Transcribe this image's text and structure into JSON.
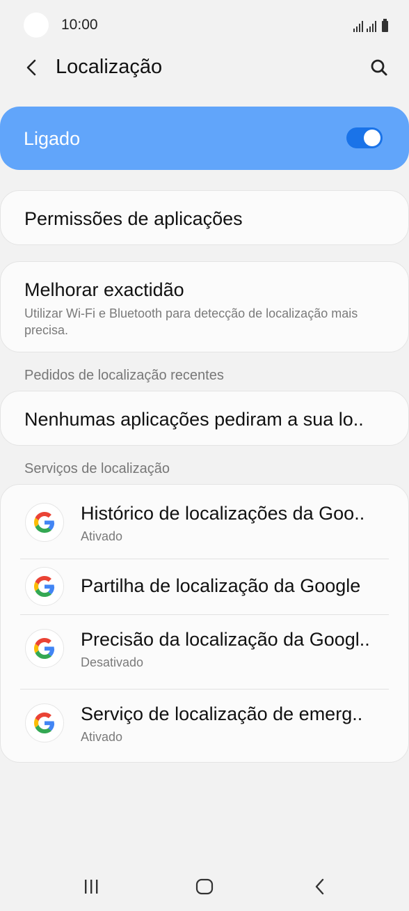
{
  "status_bar": {
    "time": "10:00"
  },
  "app_bar": {
    "title": "Localização"
  },
  "master_switch": {
    "label": "Ligado",
    "enabled": true
  },
  "app_permissions": {
    "label": "Permissões de aplicações"
  },
  "accuracy": {
    "title": "Melhorar exactidão",
    "subtitle": "Utilizar Wi-Fi e Bluetooth para detecção de localização mais precisa."
  },
  "recent_requests": {
    "header": "Pedidos de localização recentes",
    "empty_text": "Nenhumas aplicações pediram a sua lo.."
  },
  "services": {
    "header": "Serviços de localização",
    "items": [
      {
        "title": "Histórico de localizações da Goo..",
        "subtitle": "Ativado",
        "icon": "google-icon"
      },
      {
        "title": "Partilha de localização da Google",
        "subtitle": "",
        "icon": "google-icon"
      },
      {
        "title": "Precisão da localização da Googl..",
        "subtitle": "Desativado",
        "icon": "google-icon"
      },
      {
        "title": "Serviço de localização de emerg..",
        "subtitle": "Ativado",
        "icon": "google-icon"
      }
    ]
  },
  "colors": {
    "accent": "#1a73e8",
    "switch_bg": "#61a5fa",
    "background": "#f2f2f2"
  }
}
